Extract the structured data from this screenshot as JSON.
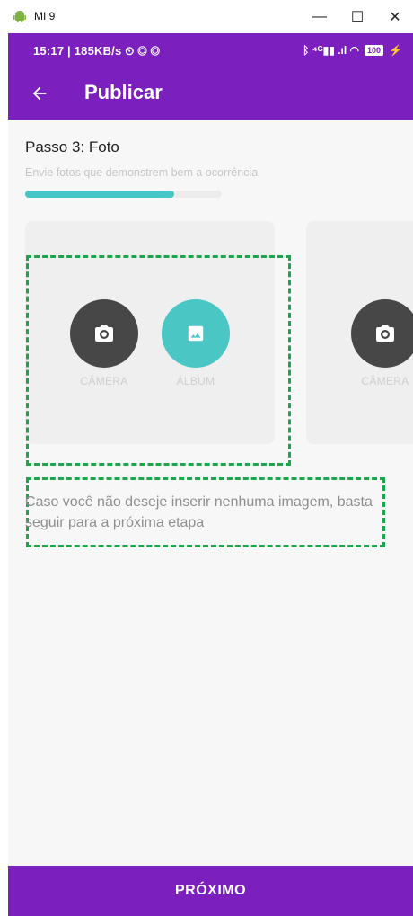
{
  "window": {
    "title": "MI 9",
    "minimize": "—",
    "maximize": "☐",
    "close": "✕"
  },
  "statusbar": {
    "left": "15:17 | 185KB/s ⏲ ◎ ◎",
    "signal": "ᛒ ⁴ᴳ▮▮ .ıl ◠",
    "battery": "100",
    "charge": "⚡"
  },
  "appbar": {
    "back_icon": "arrow-left-icon",
    "title": "Publicar"
  },
  "step": {
    "title": "Passo 3: Foto",
    "subtitle": "Envie fotos que demonstrem bem a ocorrência",
    "progress": 0.76
  },
  "cards": [
    {
      "buttons": [
        {
          "label": "CÂMERA",
          "icon": "camera-icon",
          "color": "#474747"
        },
        {
          "label": "ÁLBUM",
          "icon": "image-icon",
          "color": "#4ac6c5"
        }
      ]
    },
    {
      "buttons": [
        {
          "label": "CÂMERA",
          "icon": "camera-icon",
          "color": "#474747"
        }
      ]
    }
  ],
  "hint": "Caso você não deseje inserir nenhuma imagem, basta seguir para a próxima etapa",
  "next_button": "PRÓXIMO",
  "colors": {
    "primary": "#7b1fbf",
    "accent": "#45c6c7",
    "highlight": "#1aa64a"
  }
}
